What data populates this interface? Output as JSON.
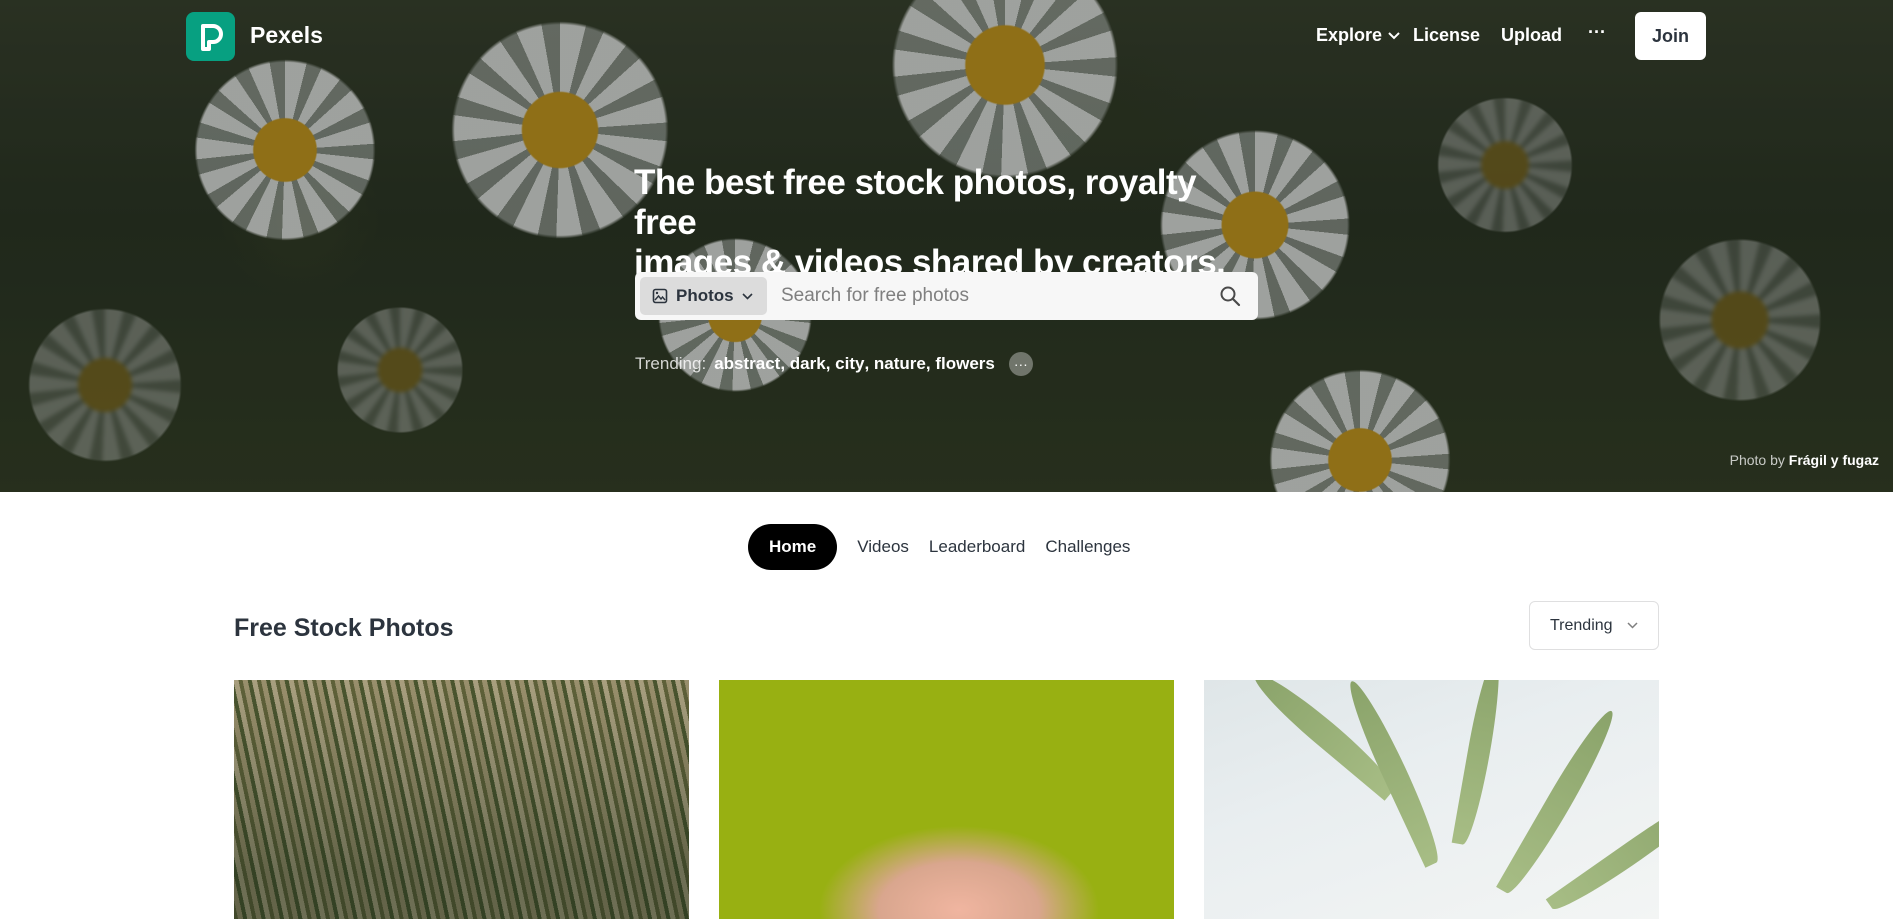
{
  "brand": {
    "name": "Pexels",
    "logo_letter": "P",
    "accent": "#07a081"
  },
  "nav": {
    "explore": "Explore",
    "license": "License",
    "upload": "Upload",
    "more": "···",
    "join": "Join"
  },
  "hero": {
    "title_line1": "The best free stock photos, royalty free",
    "title_line2": "images & videos shared by creators.",
    "search": {
      "type_label": "Photos",
      "placeholder": "Search for free photos"
    },
    "trending_label": "Trending:",
    "trending": [
      "abstract",
      "dark",
      "city",
      "nature",
      "flowers"
    ],
    "credit_prefix": "Photo by",
    "credit_author": "Frágil y fugaz"
  },
  "tabs": [
    {
      "label": "Home",
      "active": true
    },
    {
      "label": "Videos"
    },
    {
      "label": "Leaderboard"
    },
    {
      "label": "Challenges"
    }
  ],
  "section": {
    "title": "Free Stock Photos",
    "sort_value": "Trending"
  },
  "icons": {
    "logo": "pexels-logo-icon",
    "explore_chevron": "chevron-down-icon",
    "type": "image-icon",
    "search": "search-icon",
    "more": "ellipsis-icon"
  }
}
